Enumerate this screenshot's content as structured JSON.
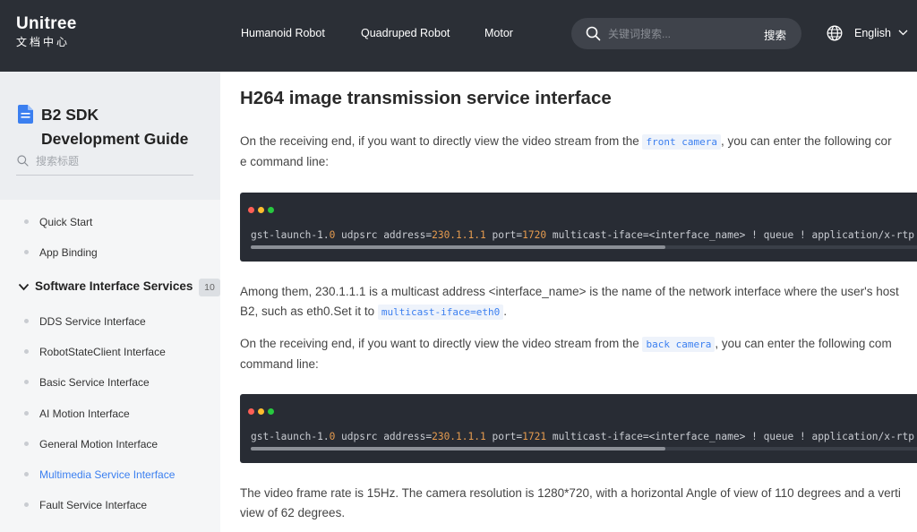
{
  "header": {
    "logo_line1": "Unitree",
    "logo_line2": "文档中心",
    "nav": [
      "Humanoid Robot",
      "Quadruped Robot",
      "Motor"
    ],
    "search_placeholder": "关键词搜索...",
    "search_button": "搜索",
    "language": "English"
  },
  "sidebar": {
    "title_line1": "B2 SDK",
    "title_line2": "Development Guide",
    "search_placeholder": "搜索标题",
    "top_items": [
      "Quick Start",
      "App Binding"
    ],
    "group": {
      "label": "Software Interface Services",
      "count": "10"
    },
    "group_items": [
      "DDS Service Interface",
      "RobotStateClient Interface",
      "Basic Service Interface",
      "AI Motion Interface",
      "General Motion Interface",
      "Multimedia Service Interface",
      "Fault Service Interface"
    ],
    "active_item": "Multimedia Service Interface"
  },
  "content": {
    "title": "H264 image transmission service interface",
    "p1_a": "On the receiving end, if you want to directly view the video stream from the ",
    "p1_code": "front camera",
    "p1_b": ", you can enter the following cor",
    "p1_c": "e command line:",
    "code1": {
      "pre": "gst-launch-1.",
      "v0": "0",
      "mid1": " udpsrc address=",
      "addr": "230.1.1.1",
      "mid2": " port=",
      "port": "1720",
      "post": " multicast-iface=<interface_name> ! queue !  application/x-rtp"
    },
    "p2_a": "Among them, 230.1.1.1 is a multicast address <interface_name> is the name of the network interface where the user's host",
    "p2_b": "B2, such as eth0.Set it to ",
    "p2_code": "multicast-iface=eth0",
    "p2_c": ".",
    "p3_a": "On the receiving end, if you want to directly view the video stream from the ",
    "p3_code": "back camera",
    "p3_b": ", you can enter the following com",
    "p3_c": "command line:",
    "code2": {
      "pre": "gst-launch-1.",
      "v0": "0",
      "mid1": " udpsrc address=",
      "addr": "230.1.1.1",
      "mid2": " port=",
      "port": "1721",
      "post": " multicast-iface=<interface_name> ! queue !  application/x-rtp"
    },
    "p4_a": "The video frame rate is 15Hz. The camera resolution is 1280*720, with a horizontal Angle of view of 110 degrees and a verti",
    "p4_b": "view of 62 degrees."
  },
  "colors": {
    "header_bg": "#2b2f36",
    "accent": "#3b7ff0",
    "code_bg": "#282c34",
    "dot_red": "#ff5f56",
    "dot_yellow": "#ffbd2e",
    "dot_green": "#27c93f"
  },
  "icons": [
    "search-icon",
    "globe-icon",
    "chevron-down-icon",
    "document-icon"
  ]
}
